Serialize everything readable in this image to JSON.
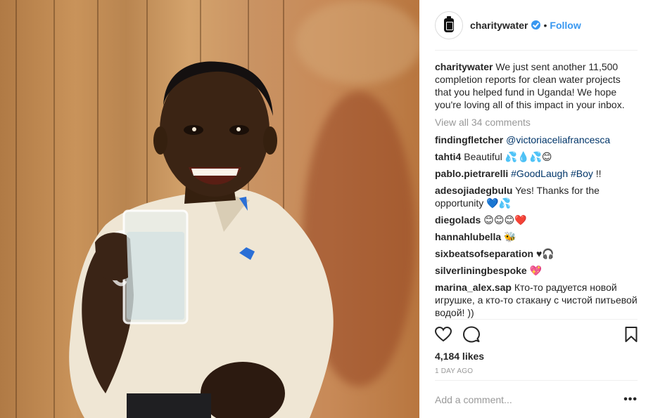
{
  "post": {
    "username": "charitywater",
    "follow_label": "Follow",
    "separator": "•",
    "caption_user": "charitywater",
    "caption_text": " We just sent another 11,500 completion reports for clean water projects that you helped fund in Uganda! We hope you're loving all of this impact in your inbox.",
    "view_all_label": "View all 34 comments",
    "likes": "4,184 likes",
    "date": "1 DAY AGO",
    "add_comment_placeholder": "Add a comment...",
    "more_label": "•••"
  },
  "comments": [
    {
      "user": "findingfletcher",
      "text": "",
      "link": "@victoriaceliafrancesca"
    },
    {
      "user": "tahti4",
      "text": " Beautiful 💦💧💦😊",
      "link": ""
    },
    {
      "user": "pablo.pietrarelli",
      "text": " ",
      "link": "#GoodLaugh #Boy",
      "tail": " !!"
    },
    {
      "user": "adesojiadegbulu",
      "text": " Yes! Thanks for the opportunity 💙💦",
      "link": ""
    },
    {
      "user": "diegolads",
      "text": " 😊😊😊❤️",
      "link": ""
    },
    {
      "user": "hannahlubella",
      "text": " 🐝",
      "link": ""
    },
    {
      "user": "sixbeatsofseparation",
      "text": " ♥🎧",
      "link": ""
    },
    {
      "user": "silverliningbespoke",
      "text": " 💖",
      "link": ""
    },
    {
      "user": "marina_alex.sap",
      "text": " Кто-то радуется новой игрушке, а кто-то стакану с чистой питьевой водой! ))",
      "link": ""
    }
  ],
  "icons": {
    "avatar": "charity-water-jerrycan-icon",
    "verified": "verified-badge-icon",
    "like": "heart-icon",
    "comment": "comment-bubble-icon",
    "save": "bookmark-icon"
  },
  "colors": {
    "accent": "#3897f0",
    "link": "#003569",
    "muted": "#999999",
    "border": "#efefef"
  }
}
